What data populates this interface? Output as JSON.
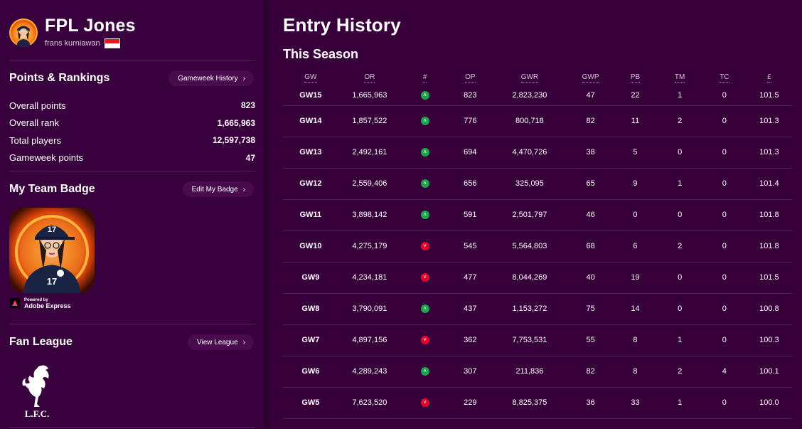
{
  "profile": {
    "manager_name": "FPL Jones",
    "team_name": "frans kurniawan",
    "flag": "indonesia-flag"
  },
  "points_rankings": {
    "title": "Points & Rankings",
    "history_button": "Gameweek History",
    "stats": [
      {
        "label": "Overall points",
        "value": "823"
      },
      {
        "label": "Overall rank",
        "value": "1,665,963"
      },
      {
        "label": "Total players",
        "value": "12,597,738"
      },
      {
        "label": "Gameweek points",
        "value": "47"
      }
    ]
  },
  "team_badge": {
    "title": "My Team Badge",
    "edit_button": "Edit My Badge",
    "powered_small": "Powered by",
    "powered_big": "Adobe Express"
  },
  "fan_league": {
    "title": "Fan League",
    "view_button": "View League",
    "crest_text": "L.F.C."
  },
  "main": {
    "title": "Entry History",
    "season_title": "This Season"
  },
  "table": {
    "headers": [
      "GW",
      "OR",
      "#",
      "OP",
      "GWR",
      "GWP",
      "PB",
      "TM",
      "TC",
      "£"
    ],
    "rows": [
      {
        "gw": "GW15",
        "or": "1,665,963",
        "dir": "up",
        "op": "823",
        "gwr": "2,823,230",
        "gwp": "47",
        "pb": "22",
        "tm": "1",
        "tc": "0",
        "val": "101.5"
      },
      {
        "gw": "GW14",
        "or": "1,857,522",
        "dir": "up",
        "op": "776",
        "gwr": "800,718",
        "gwp": "82",
        "pb": "11",
        "tm": "2",
        "tc": "0",
        "val": "101.3"
      },
      {
        "gw": "GW13",
        "or": "2,492,161",
        "dir": "up",
        "op": "694",
        "gwr": "4,470,726",
        "gwp": "38",
        "pb": "5",
        "tm": "0",
        "tc": "0",
        "val": "101.3"
      },
      {
        "gw": "GW12",
        "or": "2,559,406",
        "dir": "up",
        "op": "656",
        "gwr": "325,095",
        "gwp": "65",
        "pb": "9",
        "tm": "1",
        "tc": "0",
        "val": "101.4"
      },
      {
        "gw": "GW11",
        "or": "3,898,142",
        "dir": "up",
        "op": "591",
        "gwr": "2,501,797",
        "gwp": "46",
        "pb": "0",
        "tm": "0",
        "tc": "0",
        "val": "101.8"
      },
      {
        "gw": "GW10",
        "or": "4,275,179",
        "dir": "down",
        "op": "545",
        "gwr": "5,564,803",
        "gwp": "68",
        "pb": "6",
        "tm": "2",
        "tc": "0",
        "val": "101.8"
      },
      {
        "gw": "GW9",
        "or": "4,234,181",
        "dir": "down",
        "op": "477",
        "gwr": "8,044,269",
        "gwp": "40",
        "pb": "19",
        "tm": "0",
        "tc": "0",
        "val": "101.5"
      },
      {
        "gw": "GW8",
        "or": "3,790,091",
        "dir": "up",
        "op": "437",
        "gwr": "1,153,272",
        "gwp": "75",
        "pb": "14",
        "tm": "0",
        "tc": "0",
        "val": "100.8"
      },
      {
        "gw": "GW7",
        "or": "4,897,156",
        "dir": "down",
        "op": "362",
        "gwr": "7,753,531",
        "gwp": "55",
        "pb": "8",
        "tm": "1",
        "tc": "0",
        "val": "100.3"
      },
      {
        "gw": "GW6",
        "or": "4,289,243",
        "dir": "up",
        "op": "307",
        "gwr": "211,836",
        "gwp": "82",
        "pb": "8",
        "tm": "2",
        "tc": "4",
        "val": "100.1"
      },
      {
        "gw": "GW5",
        "or": "7,623,520",
        "dir": "down",
        "op": "229",
        "gwr": "8,825,375",
        "gwp": "36",
        "pb": "33",
        "tm": "1",
        "tc": "0",
        "val": "100.0"
      }
    ]
  },
  "colors": {
    "background": "#38003c",
    "divider": "#5a1e5e",
    "pill": "#4a0b4e",
    "rank_up": "#1ea54c",
    "rank_down": "#e0002e"
  },
  "icons": {
    "rank_up": "chevron-up-icon",
    "rank_down": "chevron-down-icon",
    "pill_chevron": "chevron-right-icon"
  }
}
